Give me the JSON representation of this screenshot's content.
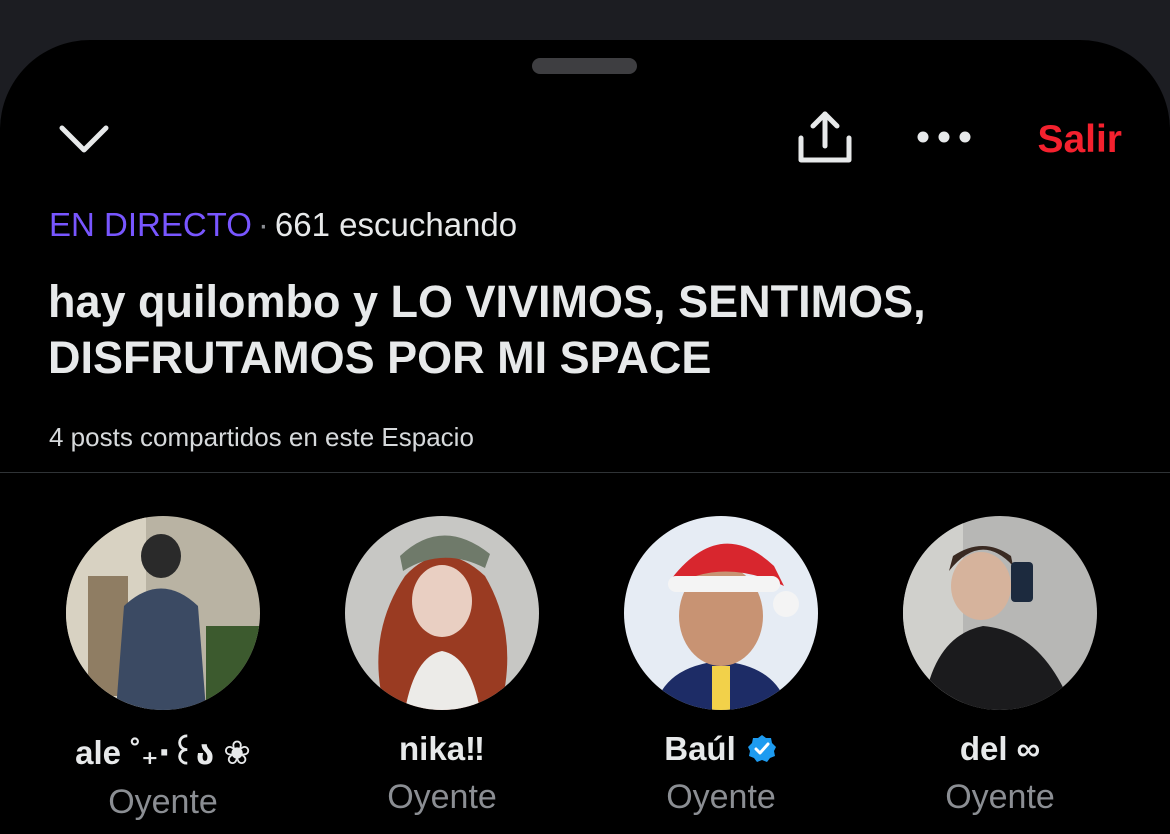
{
  "header": {
    "close_icon": "chevron-down-icon",
    "share_icon": "share-icon",
    "more_icon": "more-icon",
    "exit_label": "Salir"
  },
  "space": {
    "live_label": "EN DIRECTO",
    "separator": "·",
    "listeners": "661 escuchando",
    "title": "hay quilombo y LO VIVIMOS, SENTIMOS, DISFRUTAMOS POR MI SPACE",
    "posts_shared": "4 posts compartidos en este Espacio"
  },
  "participants": [
    {
      "name": "ale ˚₊‧꒰ა ❀",
      "role": "Oyente",
      "verified": false
    },
    {
      "name": "nika‼",
      "role": "Oyente",
      "verified": false
    },
    {
      "name": "Baúl",
      "role": "Oyente",
      "verified": true
    },
    {
      "name": "del ∞",
      "role": "Oyente",
      "verified": false
    }
  ],
  "colors": {
    "live": "#7856ff",
    "exit": "#f4212e",
    "verified": "#1d9bf0",
    "muted": "#8b8e93"
  }
}
